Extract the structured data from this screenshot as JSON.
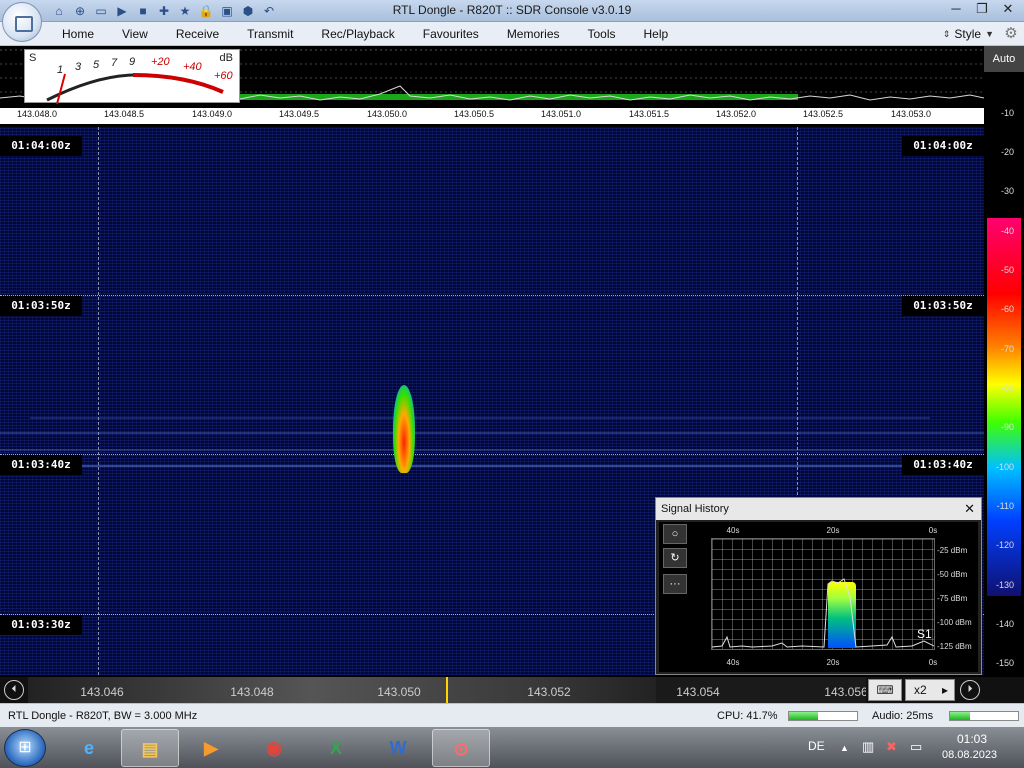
{
  "window": {
    "title": "RTL Dongle - R820T :: SDR Console v3.0.19",
    "controls": {
      "minimize": "─",
      "maximize": "❐",
      "close": "✕"
    }
  },
  "quick_access": [
    "⌂",
    "⊕",
    "▭",
    "▶",
    "■",
    "✚",
    "★",
    "🔒",
    "▣",
    "⬢",
    "↶"
  ],
  "menu": {
    "items": [
      "Home",
      "View",
      "Receive",
      "Transmit",
      "Rec/Playback",
      "Favourites",
      "Memories",
      "Tools",
      "Help"
    ],
    "style_label": "Style"
  },
  "smeter": {
    "s_label": "S",
    "db_label": "dB",
    "scale": [
      "1",
      "3",
      "5",
      "7",
      "9",
      "+20",
      "+40",
      "+60"
    ]
  },
  "spectrum_axis": {
    "ticks": [
      "143.048.0",
      "143.048.5",
      "143.049.0",
      "143.049.5",
      "143.050.0",
      "143.050.5",
      "143.051.0",
      "143.051.5",
      "143.052.0",
      "143.052.5",
      "143.053.0"
    ]
  },
  "waterfall": {
    "time_labels": [
      "01:04:00z",
      "01:03:50z",
      "01:03:40z",
      "01:03:30z"
    ]
  },
  "db_scale": {
    "mode": "Auto",
    "values": [
      "-10",
      "-20",
      "-30",
      "-40",
      "-50",
      "-60",
      "-70",
      "-80",
      "-90",
      "-100",
      "-110",
      "-120",
      "-130",
      "-140",
      "-150"
    ]
  },
  "signal_history": {
    "title": "Signal History",
    "close": "✕",
    "buttons": [
      "○",
      "↻",
      "···"
    ],
    "x_ticks": [
      "40s",
      "20s",
      "0s"
    ],
    "y_ticks": [
      "-25 dBm",
      "-50 dBm",
      "-75 dBm",
      "-100 dBm",
      "-125 dBm"
    ],
    "reading": "S1"
  },
  "tuning": {
    "freqs": [
      "143.046",
      "143.048",
      "143.050",
      "143.052",
      "143.054",
      "143.056"
    ],
    "nav_left": "⏴",
    "nav_right": "⏵",
    "keyboard": "⌨",
    "zoom": "x2",
    "zoom_arrow": "▸"
  },
  "status": {
    "device": "RTL Dongle - R820T, BW = 3.000 MHz",
    "cpu": "CPU: 41.7%",
    "cpu_level": 0.42,
    "audio": "Audio: 25ms",
    "audio_level": 0.3
  },
  "taskbar": {
    "start": "⊞",
    "apps": [
      {
        "name": "internet-explorer",
        "glyph": "e"
      },
      {
        "name": "file-explorer",
        "glyph": "▤"
      },
      {
        "name": "media-player",
        "glyph": "▶"
      },
      {
        "name": "chrome",
        "glyph": "◉"
      },
      {
        "name": "excel",
        "glyph": "X"
      },
      {
        "name": "word",
        "glyph": "W"
      },
      {
        "name": "sdr-console",
        "glyph": "⊙"
      }
    ],
    "lang": "DE",
    "tray_icons": [
      "▲",
      "▥",
      "✖",
      "▭"
    ],
    "time": "01:03",
    "date": "08.08.2023"
  }
}
